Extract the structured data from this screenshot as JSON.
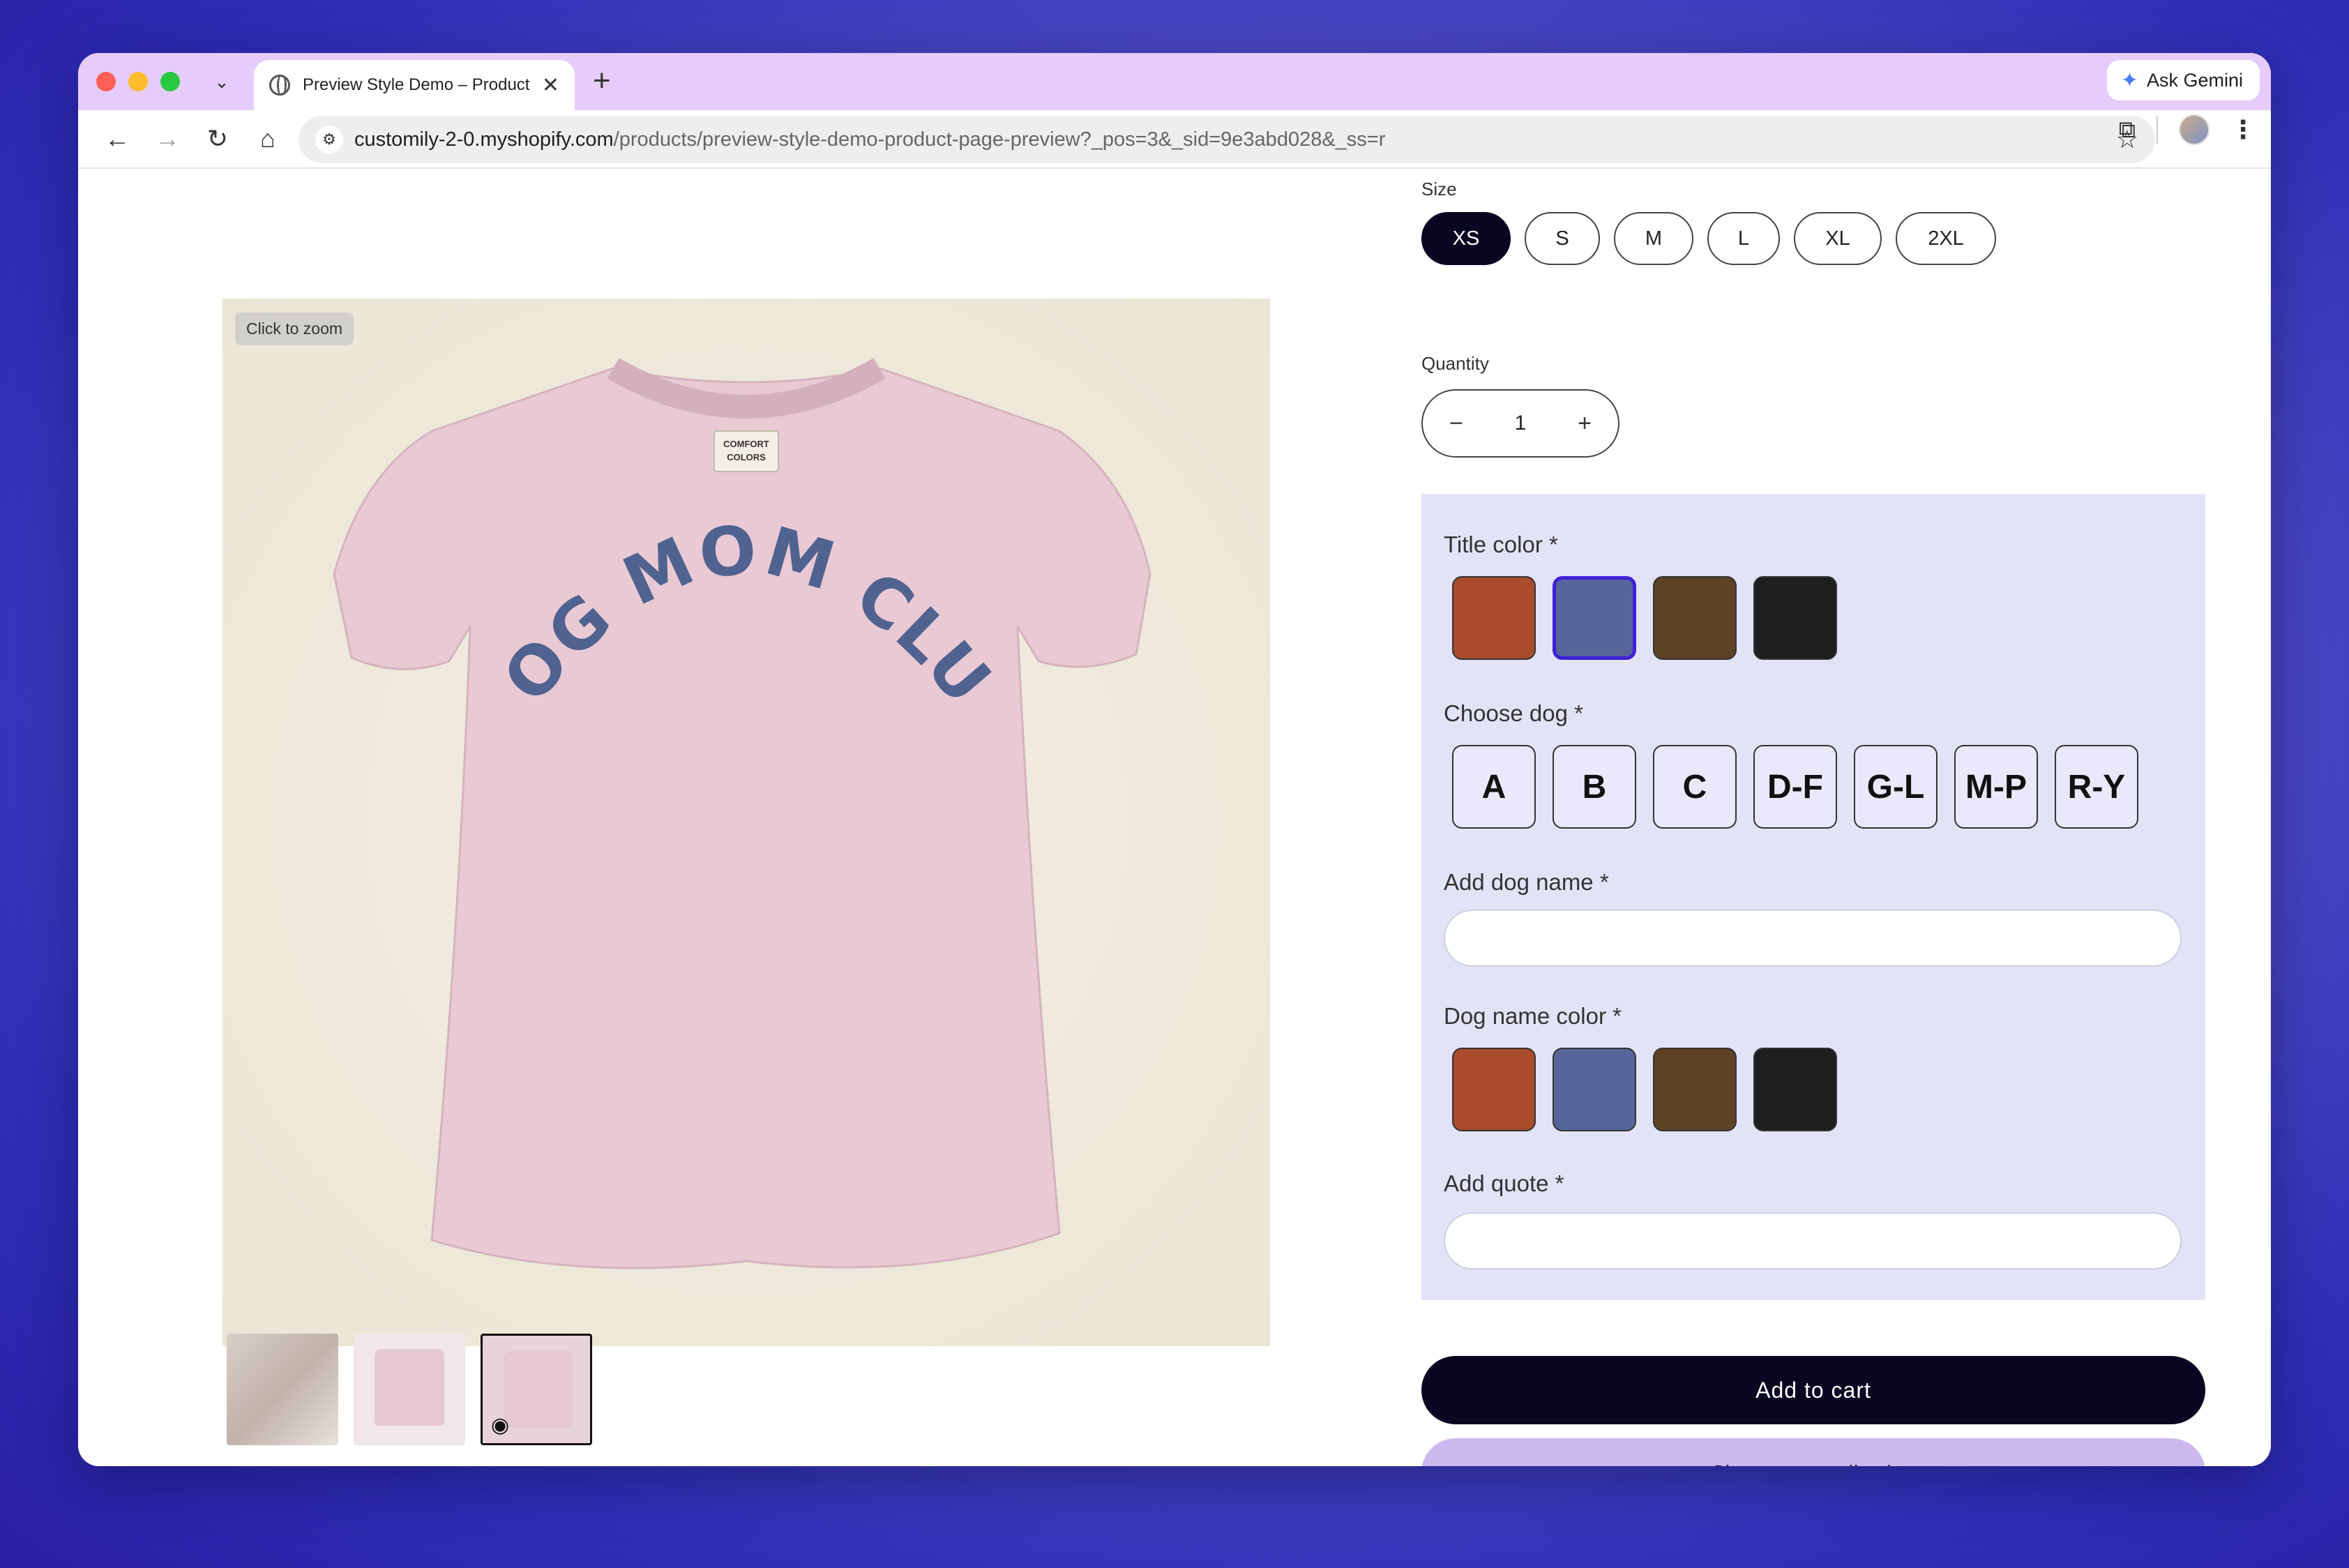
{
  "browser": {
    "tab_title": "Preview Style Demo – Product Page Preview",
    "url_domain": "customily-2-0.myshopify.com",
    "url_path": "/products/preview-style-demo-product-page-preview?_pos=3&_sid=9e3abd028&_ss=r",
    "ask_gemini": "Ask Gemini"
  },
  "gallery": {
    "zoom_hint": "Click to zoom",
    "shirt_text": "DOG MOM CLUB",
    "tag_line1": "COMFORT",
    "tag_line2": "COLORS",
    "shirt_color": "#e8c9d4",
    "print_color": "#50628f"
  },
  "product": {
    "size_label": "Size",
    "sizes": [
      "XS",
      "S",
      "M",
      "L",
      "XL",
      "2XL"
    ],
    "selected_size": "XS",
    "quantity_label": "Quantity",
    "quantity": "1",
    "minus": "−",
    "plus": "+"
  },
  "customizer": {
    "title_color_label": "Title color *",
    "title_colors": [
      "#a94c2c",
      "#56659a",
      "#5e4226",
      "#1e1e1f"
    ],
    "title_color_selected_index": 1,
    "choose_dog_label": "Choose dog *",
    "dog_options": [
      "A",
      "B",
      "C",
      "D-F",
      "G-L",
      "M-P",
      "R-Y"
    ],
    "dog_name_label": "Add dog name *",
    "dog_name_value": "",
    "dog_name_color_label": "Dog name color *",
    "dog_name_colors": [
      "#a94c2c",
      "#56659a",
      "#5e4226",
      "#1e1e1f"
    ],
    "quote_label": "Add quote *",
    "quote_value": ""
  },
  "actions": {
    "add_to_cart": "Add to cart",
    "share": "Share personalization"
  }
}
